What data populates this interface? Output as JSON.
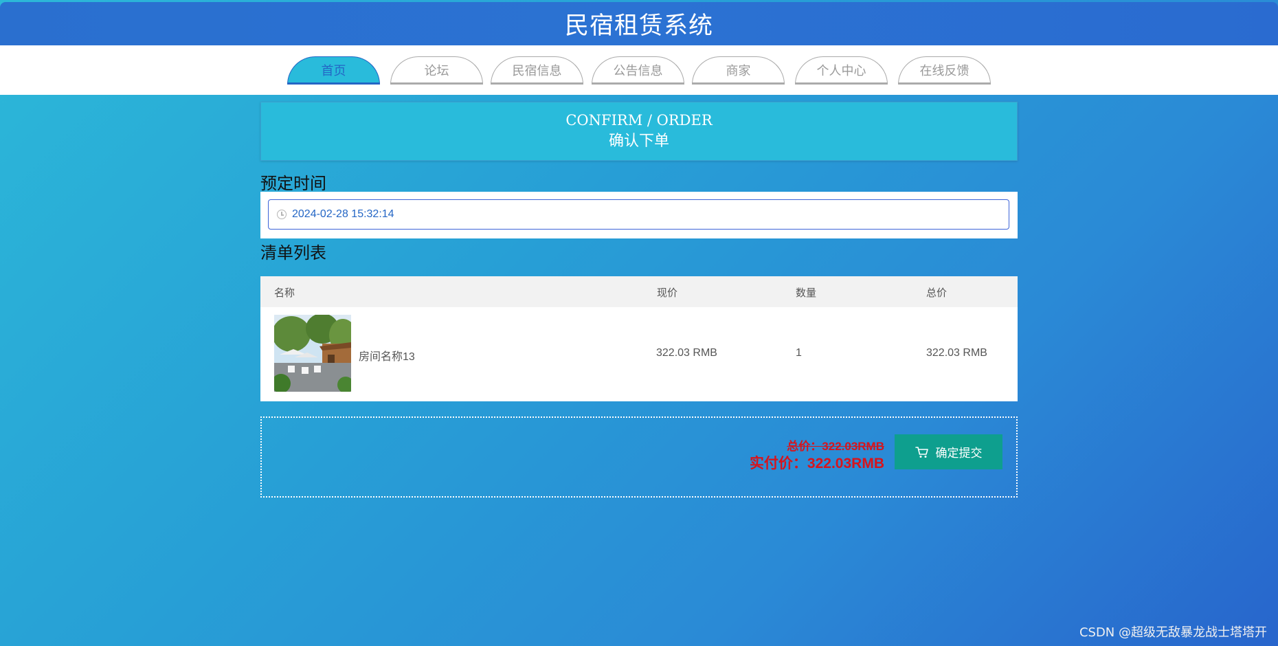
{
  "header": {
    "title": "民宿租赁系统"
  },
  "nav": {
    "tabs": [
      {
        "label": "首页",
        "active": true
      },
      {
        "label": "论坛",
        "active": false
      },
      {
        "label": "民宿信息",
        "active": false
      },
      {
        "label": "公告信息",
        "active": false
      },
      {
        "label": "商家",
        "active": false
      },
      {
        "label": "个人中心",
        "active": false
      },
      {
        "label": "在线反馈",
        "active": false
      }
    ]
  },
  "banner": {
    "title_en": "CONFIRM / ORDER",
    "title_cn": "确认下单"
  },
  "reservation": {
    "label": "预定时间",
    "time_value": "2024-02-28 15:32:14",
    "icon": "clock-icon"
  },
  "cart_list": {
    "label": "清单列表",
    "columns": {
      "name": "名称",
      "price": "现价",
      "quantity": "数量",
      "total": "总价"
    },
    "rows": [
      {
        "name": "房间名称13",
        "price": "322.03 RMB",
        "quantity": "1",
        "total": "322.03 RMB"
      }
    ]
  },
  "summary": {
    "original_total": "总价：322.03RMB",
    "actual_total": "实付价：322.03RMB",
    "submit_label": "确定提交",
    "submit_icon": "cart-icon"
  },
  "watermark": "CSDN @超级无敌暴龙战士塔塔开",
  "colors": {
    "header_bg": "#2a6fcf",
    "active_tab_bg": "#29bbdb",
    "active_tab_text": "#2466c5",
    "price_red": "#d7141c",
    "submit_green": "#0e9f8e"
  }
}
